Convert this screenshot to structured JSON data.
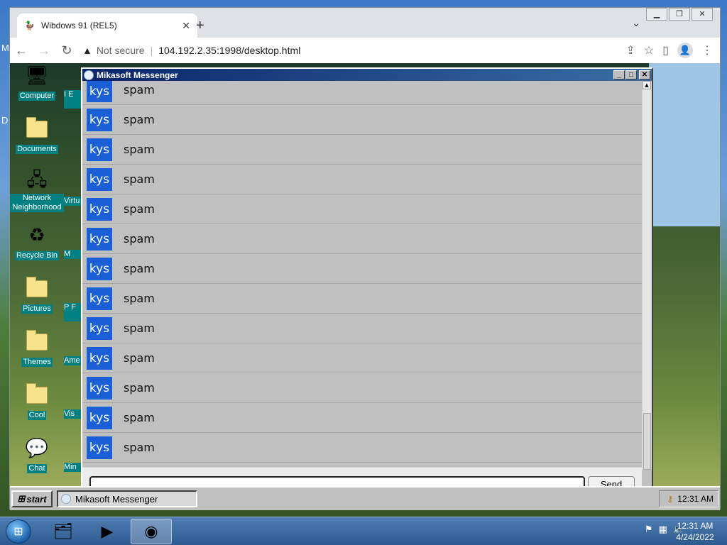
{
  "host": {
    "edge_letters": [
      "M",
      "D"
    ],
    "taskbar": {
      "pins": [
        "file-explorer",
        "media-player",
        "chrome"
      ],
      "clock_time": "12:31 AM",
      "clock_date": "4/24/2022"
    }
  },
  "browser": {
    "tab_title": "Wibdows 91 (REL5)",
    "new_tab": "+",
    "security_label": "Not secure",
    "url": "104.192.2.35:1998/desktop.html"
  },
  "desktop": {
    "icons": [
      {
        "label": "Computer",
        "glyph": "🖥"
      },
      {
        "label": "Documents",
        "glyph": "📁"
      },
      {
        "label": "Network Neighborhood",
        "glyph": "🖧"
      },
      {
        "label": "Recycle Bin",
        "glyph": "♻"
      },
      {
        "label": "Pictures",
        "glyph": "folder"
      },
      {
        "label": "Themes",
        "glyph": "folder"
      },
      {
        "label": "Cool",
        "glyph": "folder"
      },
      {
        "label": "Chat",
        "glyph": "💬"
      }
    ],
    "second_column": [
      {
        "label": "I E"
      },
      {
        "label": "Virtu"
      },
      {
        "label": "M"
      },
      {
        "label": "P F"
      },
      {
        "label": "Ame"
      },
      {
        "label": "Vis"
      },
      {
        "label": "Min"
      }
    ]
  },
  "messenger": {
    "title": "Mikasoft Messenger",
    "messages": [
      {
        "user": "kys",
        "text": "spam"
      },
      {
        "user": "kys",
        "text": "spam"
      },
      {
        "user": "kys",
        "text": "spam"
      },
      {
        "user": "kys",
        "text": "spam"
      },
      {
        "user": "kys",
        "text": "spam"
      },
      {
        "user": "kys",
        "text": "spam"
      },
      {
        "user": "kys",
        "text": "spam"
      },
      {
        "user": "kys",
        "text": "spam"
      },
      {
        "user": "kys",
        "text": "spam"
      },
      {
        "user": "kys",
        "text": "spam"
      },
      {
        "user": "kys",
        "text": "spam"
      },
      {
        "user": "kys",
        "text": "spam"
      },
      {
        "user": "kys",
        "text": "spam"
      }
    ],
    "send_label": "Send",
    "input_value": ""
  },
  "guest_taskbar": {
    "start_label": "start",
    "task_label": "Mikasoft Messenger",
    "clock": "12:31 AM"
  },
  "colors": {
    "user_badge": "#1a5fd6",
    "title_bar": "#0a246a",
    "icon_label_bg": "#008080"
  }
}
